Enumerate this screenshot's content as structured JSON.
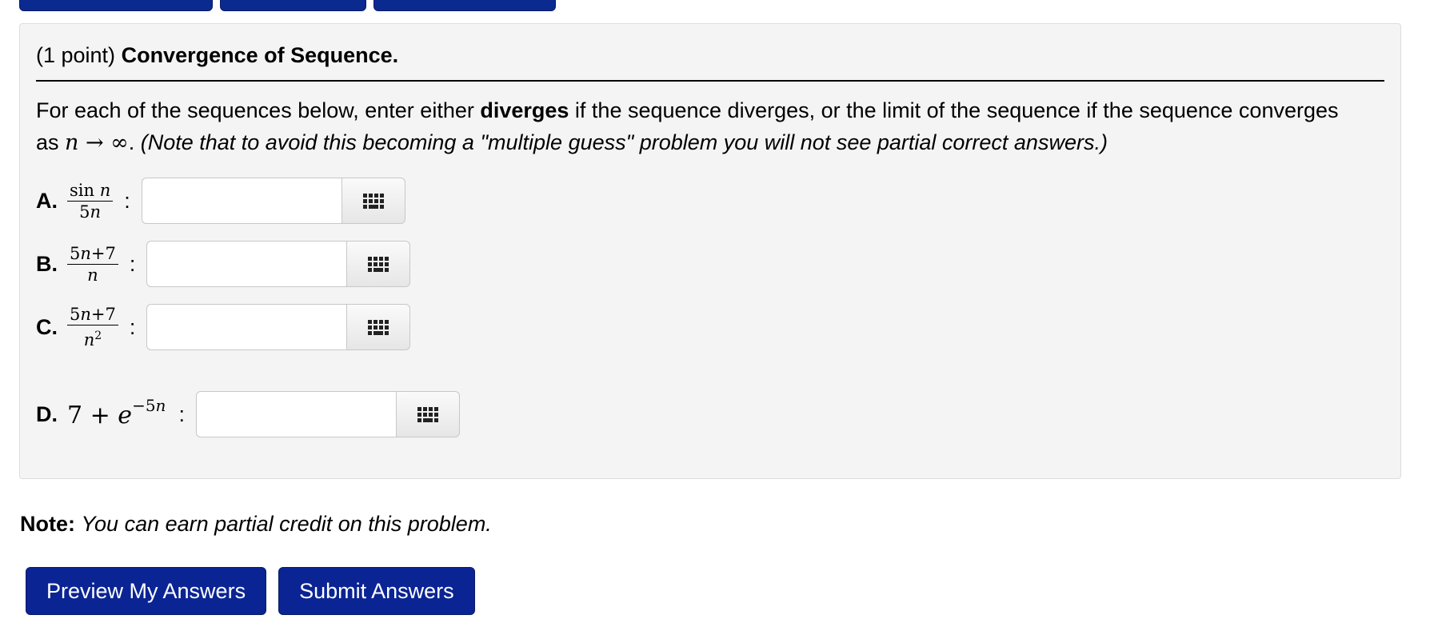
{
  "problem": {
    "points": "(1 point)",
    "title": "Convergence of Sequence.",
    "instructions": {
      "part1": "For each of the sequences below, enter either ",
      "keyword": "diverges",
      "part2": " if the sequence diverges, or the limit of the sequence if the sequence converges as ",
      "math_var": "n",
      "math_arrow": " → ∞",
      "part3": ". ",
      "note_italic": "(Note that to avoid this becoming a \"multiple guess\" problem you will not see partial correct answers.)"
    },
    "parts": [
      {
        "letter": "A.",
        "numerator": "sin n",
        "denominator": "5n",
        "value": ""
      },
      {
        "letter": "B.",
        "numerator": "5n+7",
        "denominator": "n",
        "value": ""
      },
      {
        "letter": "C.",
        "numerator": "5n+7",
        "denominator": "n2",
        "value": ""
      },
      {
        "letter": "D.",
        "expression_base": "7 + e",
        "expression_exp": "−5n",
        "value": ""
      }
    ],
    "colon": ":",
    "keyboard_icon": "keyboard-icon"
  },
  "note": {
    "label": "Note:",
    "text": "You can earn partial credit on this problem."
  },
  "actions": {
    "preview_label": "Preview My Answers",
    "submit_label": "Submit Answers"
  }
}
